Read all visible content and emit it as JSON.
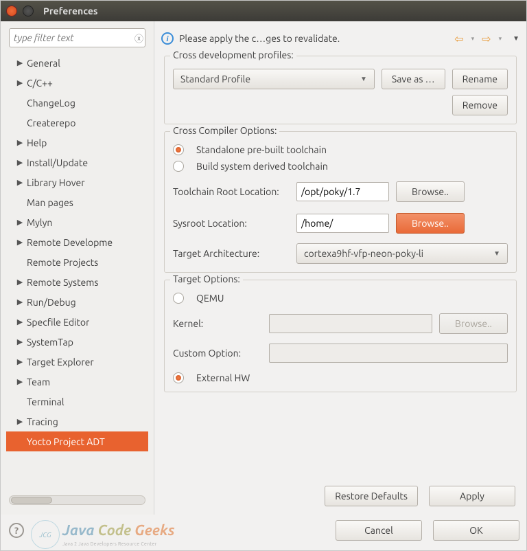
{
  "window": {
    "title": "Preferences"
  },
  "filter": {
    "placeholder": "type filter text"
  },
  "sidebar": {
    "items": [
      {
        "label": "General",
        "expandable": true
      },
      {
        "label": "C/C++",
        "expandable": true
      },
      {
        "label": "ChangeLog",
        "expandable": false
      },
      {
        "label": "Createrepo",
        "expandable": false
      },
      {
        "label": "Help",
        "expandable": true
      },
      {
        "label": "Install/Update",
        "expandable": true
      },
      {
        "label": "Library Hover",
        "expandable": true
      },
      {
        "label": "Man pages",
        "expandable": false
      },
      {
        "label": "Mylyn",
        "expandable": true
      },
      {
        "label": "Remote Developme",
        "expandable": true
      },
      {
        "label": "Remote Projects",
        "expandable": false
      },
      {
        "label": "Remote Systems",
        "expandable": true
      },
      {
        "label": "Run/Debug",
        "expandable": true
      },
      {
        "label": "Specfile Editor",
        "expandable": true
      },
      {
        "label": "SystemTap",
        "expandable": true
      },
      {
        "label": "Target Explorer",
        "expandable": true
      },
      {
        "label": "Team",
        "expandable": true
      },
      {
        "label": "Terminal",
        "expandable": false
      },
      {
        "label": "Tracing",
        "expandable": true
      },
      {
        "label": "Yocto Project ADT",
        "expandable": false,
        "selected": true
      }
    ]
  },
  "header": {
    "message": "Please apply the c…ges to revalidate."
  },
  "profiles": {
    "legend": "Cross development profiles:",
    "selected": "Standard Profile",
    "saveas": "Save as …",
    "rename": "Rename",
    "remove": "Remove"
  },
  "compiler": {
    "legend": "Cross Compiler Options:",
    "opt_standalone": "Standalone pre-built toolchain",
    "opt_derived": "Build system derived toolchain",
    "row_toolchain": "Toolchain Root Location:",
    "toolchain_value": "/opt/poky/1.7",
    "row_sysroot": "Sysroot Location:",
    "sysroot_value": "/home/",
    "row_arch": "Target Architecture:",
    "arch_value": "cortexa9hf-vfp-neon-poky-li",
    "browse": "Browse.."
  },
  "target": {
    "legend": "Target Options:",
    "opt_qemu": "QEMU",
    "row_kernel": "Kernel:",
    "row_custom": "Custom Option:",
    "browse": "Browse..",
    "opt_external": "External HW"
  },
  "actions": {
    "restore": "Restore Defaults",
    "apply": "Apply",
    "cancel": "Cancel",
    "ok": "OK"
  },
  "watermark": {
    "w1": "Java",
    "w2": "Code",
    "w3": "Geeks",
    "sub": "Java 2 Java Developers Resource Center"
  }
}
